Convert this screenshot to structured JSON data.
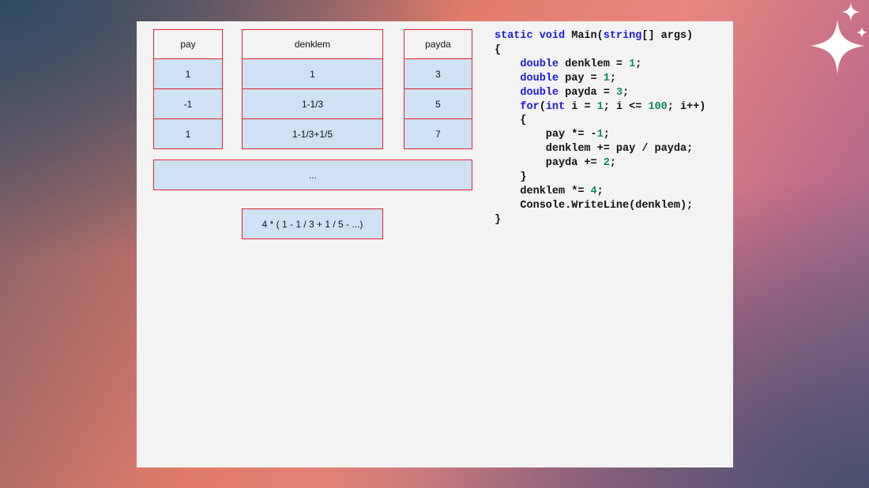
{
  "tables": {
    "pay": {
      "header": "pay",
      "values": [
        "1",
        "-1",
        "1"
      ]
    },
    "denklem": {
      "header": "denklem",
      "values": [
        "1",
        "1-1/3",
        "1-1/3+1/5"
      ]
    },
    "payda": {
      "header": "payda",
      "values": [
        "3",
        "5",
        "7"
      ]
    }
  },
  "ellipsis_box": "...",
  "formula_box": "4 * ( 1 - 1 / 3 + 1 / 5 - ...)",
  "code_lines": [
    [
      {
        "t": "static void",
        "c": "kw"
      },
      {
        "t": " Main("
      },
      {
        "t": "string",
        "c": "kw"
      },
      {
        "t": "[] args)"
      }
    ],
    [
      {
        "t": "{"
      }
    ],
    [
      {
        "t": "    "
      },
      {
        "t": "double",
        "c": "kw"
      },
      {
        "t": " denklem = "
      },
      {
        "t": "1",
        "c": "num"
      },
      {
        "t": ";"
      }
    ],
    [
      {
        "t": "    "
      },
      {
        "t": "double",
        "c": "kw"
      },
      {
        "t": " pay = "
      },
      {
        "t": "1",
        "c": "num"
      },
      {
        "t": ";"
      }
    ],
    [
      {
        "t": "    "
      },
      {
        "t": "double",
        "c": "kw"
      },
      {
        "t": " payda = "
      },
      {
        "t": "3",
        "c": "num"
      },
      {
        "t": ";"
      }
    ],
    [
      {
        "t": "    "
      },
      {
        "t": "for",
        "c": "kw"
      },
      {
        "t": "("
      },
      {
        "t": "int",
        "c": "kw"
      },
      {
        "t": " i = "
      },
      {
        "t": "1",
        "c": "num"
      },
      {
        "t": "; i <= "
      },
      {
        "t": "100",
        "c": "num"
      },
      {
        "t": "; i++)"
      }
    ],
    [
      {
        "t": "    {"
      }
    ],
    [
      {
        "t": "        pay *= -"
      },
      {
        "t": "1",
        "c": "num"
      },
      {
        "t": ";"
      }
    ],
    [
      {
        "t": "        denklem += pay / payda;"
      }
    ],
    [
      {
        "t": "        payda += "
      },
      {
        "t": "2",
        "c": "num"
      },
      {
        "t": ";"
      }
    ],
    [
      {
        "t": "    }"
      }
    ],
    [
      {
        "t": "    denklem *= "
      },
      {
        "t": "4",
        "c": "num"
      },
      {
        "t": ";"
      }
    ],
    [
      {
        "t": "    Console.WriteLine(denklem);"
      }
    ],
    [
      {
        "t": "}"
      }
    ]
  ],
  "colors": {
    "cell_border": "#e0212e",
    "cell_fill": "#cfe2f3",
    "keyword": "#1a1ad6",
    "number": "#0b8a5a"
  },
  "icons": [
    "sparkle-icon"
  ]
}
